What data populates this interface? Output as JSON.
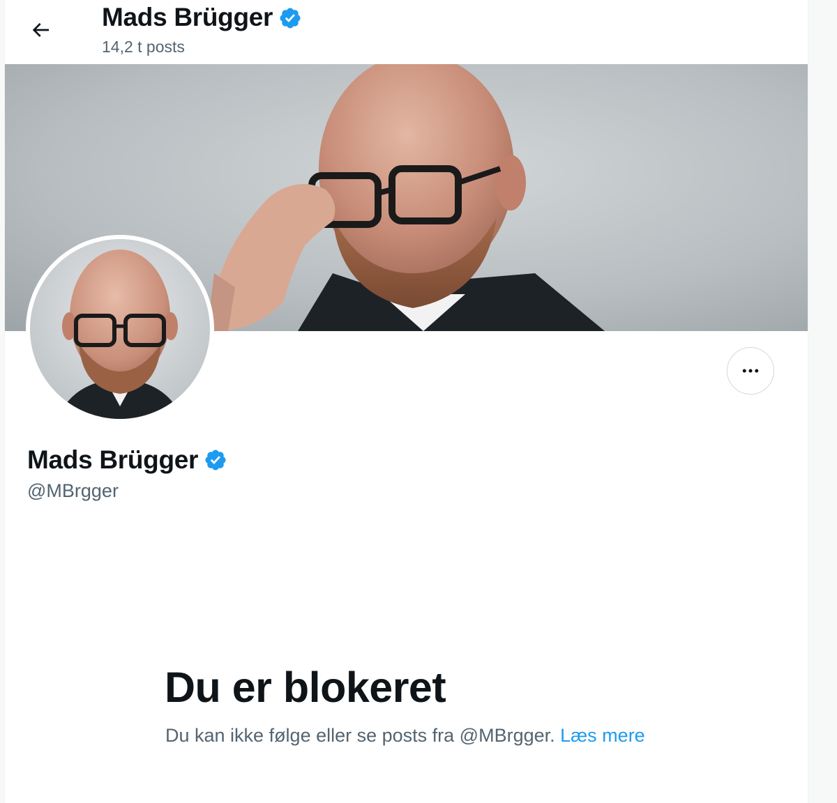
{
  "header": {
    "back_icon": "arrow-left-icon",
    "name": "Mads Brügger",
    "posts_count": "14,2 t posts",
    "verified_icon": "verified-badge-icon"
  },
  "banner": {
    "image": "banner-photo"
  },
  "profile": {
    "avatar": "avatar-photo",
    "name": "Mads Brügger",
    "handle": "@MBrgger",
    "verified_icon": "verified-badge-icon",
    "more_icon": "more-horizontal-icon"
  },
  "blocked": {
    "title": "Du er blokeret",
    "description": "Du kan ikke følge eller se posts fra @MBrgger.",
    "link_text": "Læs mere"
  },
  "colors": {
    "accent": "#1d9bf0",
    "text_primary": "#0f1419",
    "text_secondary": "#536471",
    "border": "#cfd9de"
  }
}
